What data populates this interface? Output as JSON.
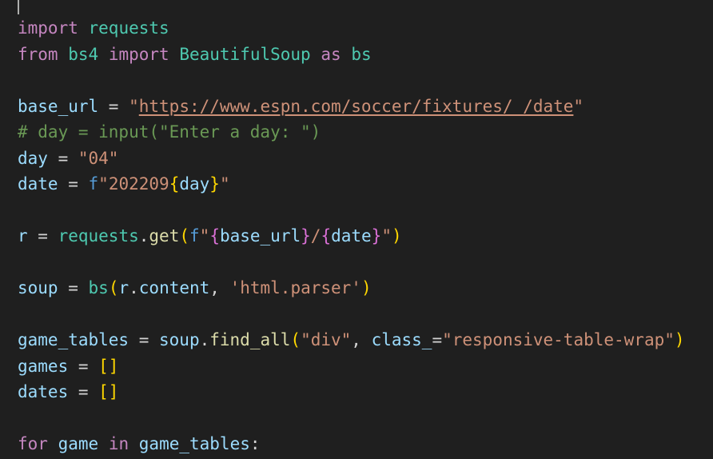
{
  "editor": {
    "lines": [
      {
        "tokens": [
          {
            "t": "import",
            "c": "kw-ctrl"
          },
          {
            "t": " ",
            "c": "op"
          },
          {
            "t": "requests",
            "c": "mod"
          }
        ]
      },
      {
        "tokens": [
          {
            "t": "from",
            "c": "kw-ctrl"
          },
          {
            "t": " ",
            "c": "op"
          },
          {
            "t": "bs4",
            "c": "mod"
          },
          {
            "t": " ",
            "c": "op"
          },
          {
            "t": "import",
            "c": "kw-ctrl"
          },
          {
            "t": " ",
            "c": "op"
          },
          {
            "t": "BeautifulSoup",
            "c": "mod"
          },
          {
            "t": " ",
            "c": "op"
          },
          {
            "t": "as",
            "c": "kw-ctrl"
          },
          {
            "t": " ",
            "c": "op"
          },
          {
            "t": "bs",
            "c": "mod"
          }
        ]
      },
      {
        "tokens": []
      },
      {
        "tokens": [
          {
            "t": "base_url",
            "c": "var"
          },
          {
            "t": " = ",
            "c": "op"
          },
          {
            "t": "\"",
            "c": "str"
          },
          {
            "t": "https://www.espn.com/soccer/fixtures/_/date",
            "c": "str url"
          },
          {
            "t": "\"",
            "c": "str"
          }
        ]
      },
      {
        "tokens": [
          {
            "t": "# day = input(\"Enter a day: \")",
            "c": "cm"
          }
        ]
      },
      {
        "tokens": [
          {
            "t": "day",
            "c": "var"
          },
          {
            "t": " = ",
            "c": "op"
          },
          {
            "t": "\"04\"",
            "c": "str"
          }
        ]
      },
      {
        "tokens": [
          {
            "t": "date",
            "c": "var"
          },
          {
            "t": " = ",
            "c": "op"
          },
          {
            "t": "f",
            "c": "kw"
          },
          {
            "t": "\"202209",
            "c": "str"
          },
          {
            "t": "{",
            "c": "br1"
          },
          {
            "t": "day",
            "c": "var"
          },
          {
            "t": "}",
            "c": "br1"
          },
          {
            "t": "\"",
            "c": "str"
          }
        ]
      },
      {
        "tokens": []
      },
      {
        "tokens": [
          {
            "t": "r",
            "c": "var"
          },
          {
            "t": " = ",
            "c": "op"
          },
          {
            "t": "requests",
            "c": "mod"
          },
          {
            "t": ".",
            "c": "op"
          },
          {
            "t": "get",
            "c": "fn"
          },
          {
            "t": "(",
            "c": "br1"
          },
          {
            "t": "f",
            "c": "kw"
          },
          {
            "t": "\"",
            "c": "str"
          },
          {
            "t": "{",
            "c": "br2"
          },
          {
            "t": "base_url",
            "c": "var"
          },
          {
            "t": "}",
            "c": "br2"
          },
          {
            "t": "/",
            "c": "str"
          },
          {
            "t": "{",
            "c": "br2"
          },
          {
            "t": "date",
            "c": "var"
          },
          {
            "t": "}",
            "c": "br2"
          },
          {
            "t": "\"",
            "c": "str"
          },
          {
            "t": ")",
            "c": "br1"
          }
        ]
      },
      {
        "tokens": []
      },
      {
        "tokens": [
          {
            "t": "soup",
            "c": "var"
          },
          {
            "t": " = ",
            "c": "op"
          },
          {
            "t": "bs",
            "c": "mod"
          },
          {
            "t": "(",
            "c": "br1"
          },
          {
            "t": "r",
            "c": "var"
          },
          {
            "t": ".",
            "c": "op"
          },
          {
            "t": "content",
            "c": "var"
          },
          {
            "t": ", ",
            "c": "op"
          },
          {
            "t": "'html.parser'",
            "c": "str"
          },
          {
            "t": ")",
            "c": "br1"
          }
        ]
      },
      {
        "tokens": []
      },
      {
        "tokens": [
          {
            "t": "game_tables",
            "c": "var"
          },
          {
            "t": " = ",
            "c": "op"
          },
          {
            "t": "soup",
            "c": "var"
          },
          {
            "t": ".",
            "c": "op"
          },
          {
            "t": "find_all",
            "c": "fn"
          },
          {
            "t": "(",
            "c": "br1"
          },
          {
            "t": "\"div\"",
            "c": "str"
          },
          {
            "t": ", ",
            "c": "op"
          },
          {
            "t": "class_",
            "c": "var"
          },
          {
            "t": "=",
            "c": "op"
          },
          {
            "t": "\"responsive-table-wrap\"",
            "c": "str"
          },
          {
            "t": ")",
            "c": "br1"
          }
        ]
      },
      {
        "tokens": [
          {
            "t": "games",
            "c": "var"
          },
          {
            "t": " = ",
            "c": "op"
          },
          {
            "t": "[]",
            "c": "br1"
          }
        ]
      },
      {
        "tokens": [
          {
            "t": "dates",
            "c": "var"
          },
          {
            "t": " = ",
            "c": "op"
          },
          {
            "t": "[]",
            "c": "br1"
          }
        ]
      },
      {
        "tokens": []
      },
      {
        "tokens": [
          {
            "t": "for",
            "c": "kw-ctrl"
          },
          {
            "t": " ",
            "c": "op"
          },
          {
            "t": "game",
            "c": "var"
          },
          {
            "t": " ",
            "c": "op"
          },
          {
            "t": "in",
            "c": "kw-ctrl"
          },
          {
            "t": " ",
            "c": "op"
          },
          {
            "t": "game_tables",
            "c": "var"
          },
          {
            "t": ":",
            "c": "op"
          }
        ]
      }
    ]
  },
  "colors": {
    "background": "#1f1f1f",
    "keyword_control": "#c586c0",
    "keyword": "#569cd6",
    "module": "#4ec9b0",
    "variable": "#9cdcfe",
    "function": "#dcdcaa",
    "string": "#ce9178",
    "comment": "#6a9955",
    "bracket_level1": "#ffd700",
    "bracket_level2": "#da70d6"
  }
}
